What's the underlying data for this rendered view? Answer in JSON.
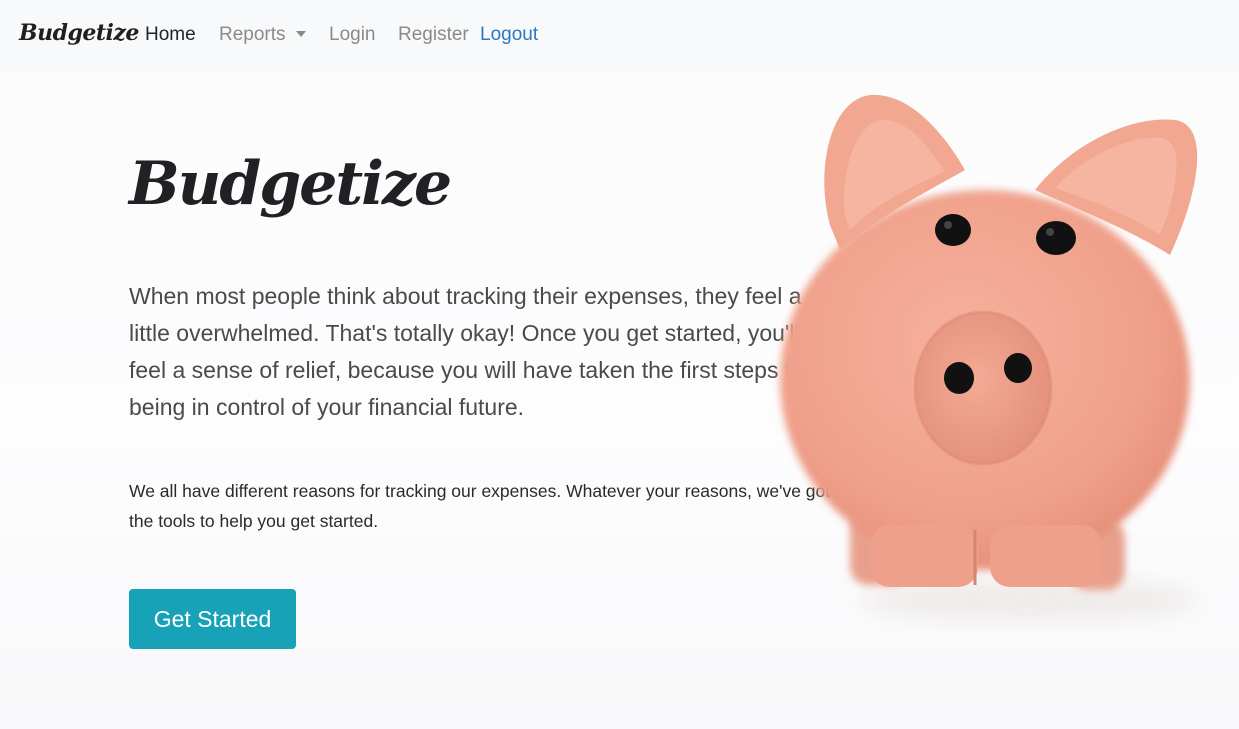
{
  "navbar": {
    "brand": "Budgetize",
    "links": {
      "home": "Home",
      "reports": "Reports",
      "login": "Login",
      "register": "Register",
      "logout": "Logout"
    }
  },
  "hero": {
    "title": "Budgetize",
    "lead": "When most people think about tracking their expenses, they feel a little overwhelmed. That's totally okay! Once you get started, you'll feel a sense of relief, because you will have taken the first steps to being in control of your financial future.",
    "subtext": "We all have different reasons for tracking our expenses. Whatever your reasons, we've got the tools to help you get started.",
    "cta": "Get Started"
  },
  "image": {
    "subject": "piggy-bank",
    "colors": {
      "pig": "#f1a48f",
      "pig_shadow": "#e08a76",
      "ear_inner": "#f4b49f",
      "eyes": "#111111"
    }
  },
  "colors": {
    "navbar_bg": "#f8f9fa",
    "link_muted": "#8a8a8a",
    "link_active": "#212529",
    "link_logout": "#2b78c2",
    "button_bg": "#17a2b8",
    "button_text": "#ffffff"
  }
}
